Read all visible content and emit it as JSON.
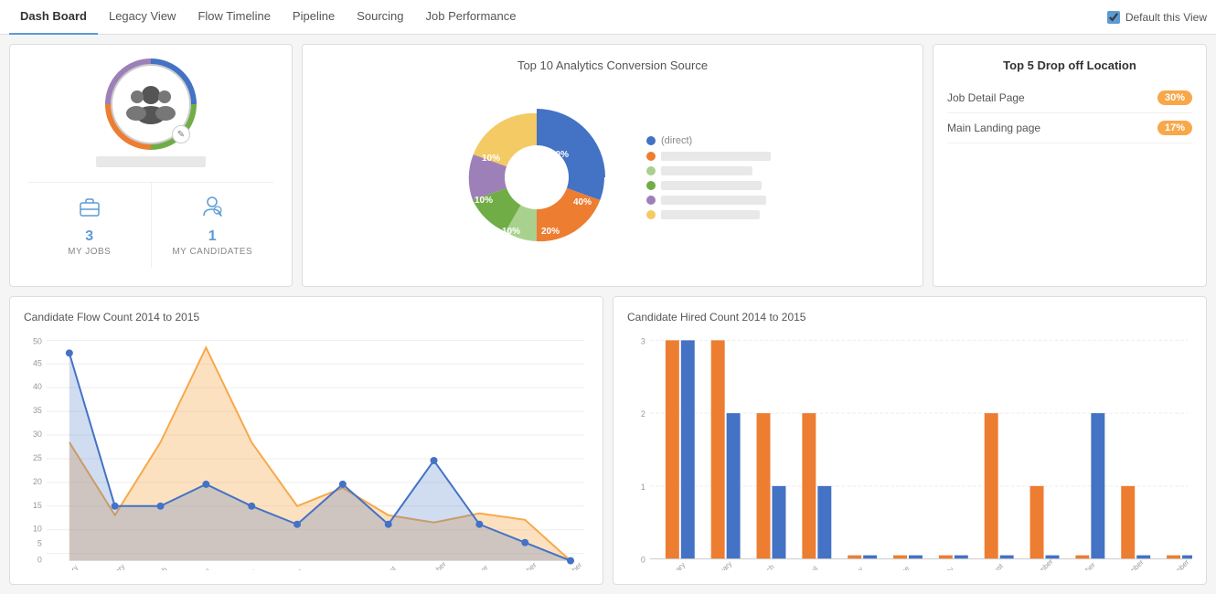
{
  "nav": {
    "items": [
      {
        "label": "Dash Board",
        "active": true
      },
      {
        "label": "Legacy View",
        "active": false
      },
      {
        "label": "Flow Timeline",
        "active": false
      },
      {
        "label": "Pipeline",
        "active": false
      },
      {
        "label": "Sourcing",
        "active": false
      },
      {
        "label": "Job Performance",
        "active": false
      }
    ],
    "default_view_label": "Default this View"
  },
  "profile": {
    "name_placeholder": "Name Placeholder",
    "my_jobs_count": "3",
    "my_jobs_label": "MY JOBS",
    "my_candidates_count": "1",
    "my_candidates_label": "MY CANDIDATES"
  },
  "analytics": {
    "title": "Top 10 Analytics Conversion Source",
    "segments": [
      {
        "label": "(direct)",
        "color": "#4472C4",
        "percent": 40,
        "text": "40%"
      },
      {
        "label": "blurred-url-1",
        "color": "#ED7D31",
        "percent": 20,
        "text": "20%"
      },
      {
        "label": "blurred-url-2",
        "color": "#A9D18E",
        "percent": 10,
        "text": "10%"
      },
      {
        "label": "blurred-url-3",
        "color": "#70AD47",
        "percent": 10,
        "text": "10%"
      },
      {
        "label": "blurred-url-4",
        "color": "#9E80B8",
        "percent": 10,
        "text": "10%"
      },
      {
        "label": "blurred-url-5",
        "color": "#ED7D31",
        "percent": 10,
        "text": "10%"
      }
    ]
  },
  "dropoff": {
    "title": "Top 5 Drop off Location",
    "items": [
      {
        "label": "Job Detail Page",
        "badge": "30%"
      },
      {
        "label": "Main Landing page",
        "badge": "17%"
      }
    ]
  },
  "flow_chart": {
    "title": "Candidate Flow Count 2014 to 2015",
    "y_max": 50,
    "y_labels": [
      "50",
      "45",
      "40",
      "35",
      "30",
      "25",
      "20",
      "15",
      "10",
      "5",
      "0"
    ],
    "x_labels": [
      "January",
      "February",
      "March",
      "April",
      "May",
      "June",
      "July",
      "August",
      "September",
      "October",
      "November",
      "December"
    ]
  },
  "hired_chart": {
    "title": "Candidate Hired Count 2014 to 2015",
    "y_max": 3,
    "y_labels": [
      "3",
      "2",
      "1",
      "0"
    ],
    "x_labels": [
      "January",
      "February",
      "March",
      "April",
      "May",
      "June",
      "July",
      "August",
      "September",
      "October",
      "November",
      "December"
    ]
  },
  "colors": {
    "blue_nav": "#5b9bd5",
    "orange": "#f7a84a",
    "chart_blue": "#4472C4",
    "chart_orange": "#ED7D31"
  }
}
